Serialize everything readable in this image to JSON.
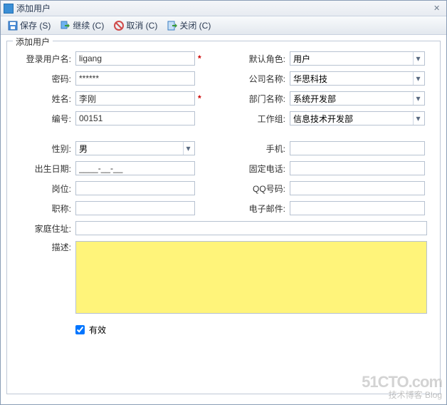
{
  "window": {
    "title": "添加用户"
  },
  "toolbar": {
    "save": "保存 (S)",
    "continue": "继续 (C)",
    "cancel": "取消 (C)",
    "close": "关闭 (C)"
  },
  "legend": "添加用户",
  "labels": {
    "login": "登录用户名:",
    "password": "密码:",
    "name": "姓名:",
    "number": "编号:",
    "default_role": "默认角色:",
    "company": "公司名称:",
    "dept": "部门名称:",
    "workgroup": "工作组:",
    "gender": "性别:",
    "mobile": "手机:",
    "birth": "出生日期:",
    "phone": "固定电话:",
    "post": "岗位:",
    "qq": "QQ号码:",
    "title": "职称:",
    "email": "电子邮件:",
    "address": "家庭住址:",
    "desc": "描述:",
    "valid": "有效"
  },
  "values": {
    "login": "ligang",
    "password": "******",
    "name": "李刚",
    "number": "00151",
    "default_role": "用户",
    "company": "华思科技",
    "dept": "系统开发部",
    "workgroup": "信息技术开发部",
    "gender": "男",
    "birth": "____-__-__",
    "mobile": "",
    "phone": "",
    "qq": "",
    "email": "",
    "post": "",
    "title": "",
    "address": "",
    "desc": "",
    "valid_checked": true
  },
  "watermark": {
    "big": "51CTO.com",
    "small": "技术博客  Blog"
  }
}
